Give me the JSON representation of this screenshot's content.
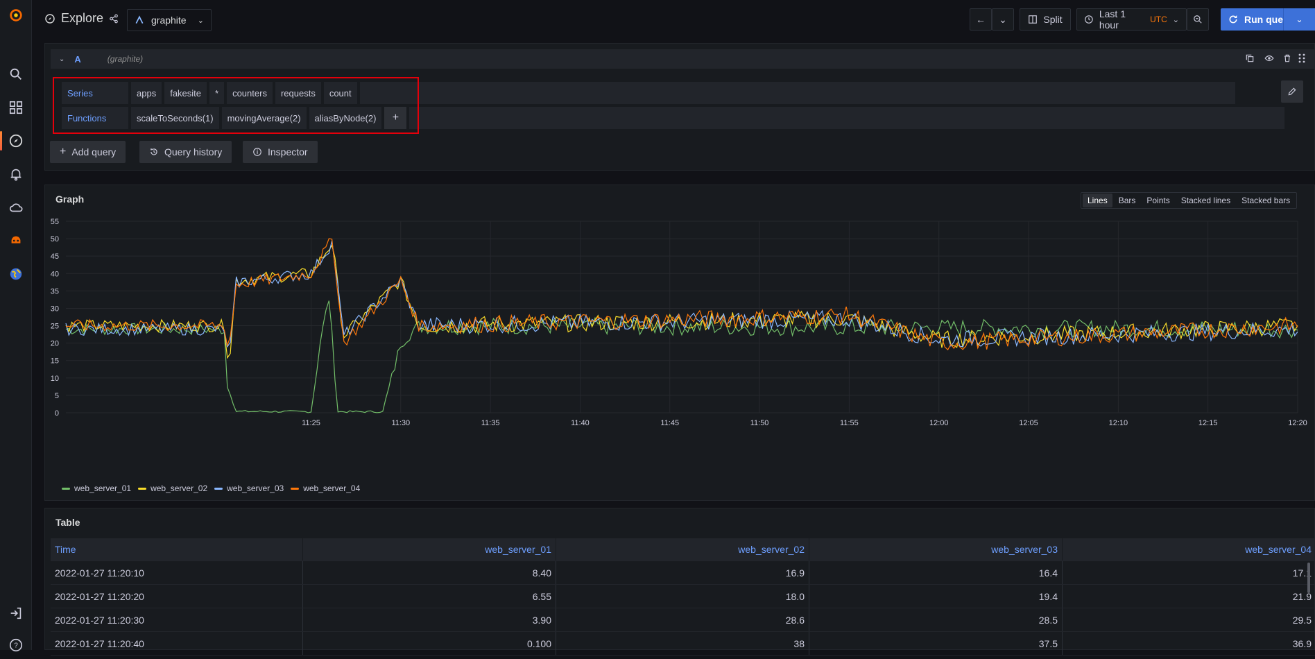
{
  "app": {
    "title": "Explore",
    "datasource": "graphite"
  },
  "toolbar": {
    "split_label": "Split",
    "time_range": "Last 1 hour",
    "timezone": "UTC",
    "run_label": "Run query"
  },
  "query": {
    "ref_id": "A",
    "datasource_note": "(graphite)",
    "series_label": "Series",
    "series_segments": [
      "apps",
      "fakesite",
      "*",
      "counters",
      "requests",
      "count"
    ],
    "functions_label": "Functions",
    "functions": [
      "scaleToSeconds(1)",
      "movingAverage(2)",
      "aliasByNode(2)"
    ],
    "add_function": "+"
  },
  "actions": {
    "add_query": "Add query",
    "query_history": "Query history",
    "inspector": "Inspector"
  },
  "graph": {
    "title": "Graph",
    "view_modes": [
      "Lines",
      "Bars",
      "Points",
      "Stacked lines",
      "Stacked bars"
    ],
    "active_view": "Lines"
  },
  "chart_data": {
    "type": "line",
    "title": "",
    "ylim": [
      0,
      55
    ],
    "yticks": [
      0,
      5,
      10,
      15,
      20,
      25,
      30,
      35,
      40,
      45,
      50,
      55
    ],
    "xlabels": [
      "11:25",
      "11:30",
      "11:35",
      "11:40",
      "11:45",
      "11:50",
      "11:55",
      "12:00",
      "12:05",
      "12:10",
      "12:15",
      "12:20"
    ],
    "xrange_minutes": [
      11.333,
      80
    ],
    "series": [
      {
        "name": "web_server_01",
        "color": "#73bf69"
      },
      {
        "name": "web_server_02",
        "color": "#fade2a"
      },
      {
        "name": "web_server_03",
        "color": "#8ab8ff"
      },
      {
        "name": "web_server_04",
        "color": "#ff780a"
      }
    ],
    "key_points": {
      "web_server_01": [
        [
          20.17,
          8.4
        ],
        [
          20.5,
          6.55
        ],
        [
          20.67,
          3.9
        ],
        [
          20.83,
          0.1
        ],
        [
          25,
          0
        ],
        [
          25.5,
          20
        ],
        [
          26,
          33
        ],
        [
          26.5,
          0
        ],
        [
          29,
          0
        ],
        [
          30,
          20
        ],
        [
          31,
          25
        ],
        [
          80,
          24
        ]
      ],
      "web_server_02": [
        [
          20.17,
          16.9
        ],
        [
          20.5,
          18
        ],
        [
          20.67,
          28.6
        ],
        [
          20.83,
          38
        ],
        [
          25,
          40
        ],
        [
          26.2,
          49
        ],
        [
          26.8,
          22
        ],
        [
          30,
          38
        ],
        [
          31,
          25
        ],
        [
          55,
          27
        ],
        [
          60,
          21
        ],
        [
          80,
          25
        ]
      ],
      "web_server_03": [
        [
          20.17,
          16.4
        ],
        [
          20.5,
          19.4
        ],
        [
          20.67,
          28.5
        ],
        [
          20.83,
          37.5
        ],
        [
          25,
          40
        ],
        [
          26.2,
          49
        ],
        [
          26.8,
          22
        ],
        [
          30,
          38
        ],
        [
          31,
          25
        ],
        [
          55,
          27
        ],
        [
          60,
          21
        ],
        [
          80,
          24
        ]
      ],
      "web_server_04": [
        [
          20.17,
          17.1
        ],
        [
          20.5,
          21.9
        ],
        [
          20.67,
          29.5
        ],
        [
          20.83,
          36.9
        ],
        [
          25,
          40
        ],
        [
          26.2,
          50
        ],
        [
          26.8,
          20
        ],
        [
          30,
          38
        ],
        [
          31,
          25
        ],
        [
          55,
          28
        ],
        [
          60,
          20
        ],
        [
          80,
          25
        ]
      ]
    }
  },
  "table": {
    "title": "Table",
    "columns": [
      "Time",
      "web_server_01",
      "web_server_02",
      "web_server_03",
      "web_server_04"
    ],
    "rows": [
      [
        "2022-01-27 11:20:10",
        "8.40",
        "16.9",
        "16.4",
        "17.1"
      ],
      [
        "2022-01-27 11:20:20",
        "6.55",
        "18.0",
        "19.4",
        "21.9"
      ],
      [
        "2022-01-27 11:20:30",
        "3.90",
        "28.6",
        "28.5",
        "29.5"
      ],
      [
        "2022-01-27 11:20:40",
        "0.100",
        "38",
        "37.5",
        "36.9"
      ]
    ]
  }
}
